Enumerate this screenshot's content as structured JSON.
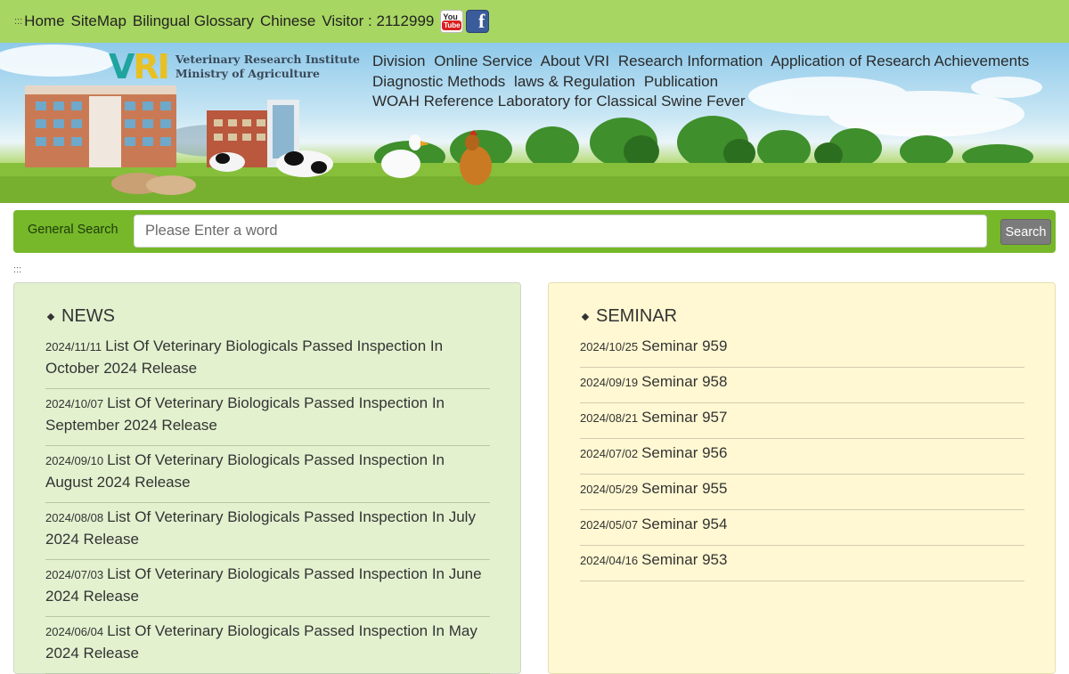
{
  "topbar": {
    "accesskey": ":::",
    "links": [
      "Home",
      "SiteMap",
      "Bilingual Glossary",
      "Chinese"
    ],
    "visitor_label": "Visitor : 2112999",
    "youtube_top": "You",
    "youtube_bottom": "Tube",
    "facebook_glyph": "f"
  },
  "logo": {
    "mark_v": "V",
    "mark_ri": "RI",
    "line1": "Veterinary Research Institute",
    "line2": "Ministry of Agriculture"
  },
  "nav": {
    "row1": [
      "Division",
      "Online Service",
      "About VRI",
      "Research Information",
      "Application of Research Achievements"
    ],
    "row2": [
      "Diagnostic Methods",
      "laws & Regulation",
      "Publication"
    ],
    "row3": [
      "WOAH Reference Laboratory for Classical Swine Fever"
    ]
  },
  "search": {
    "label": "General Search",
    "placeholder": "Please Enter a word",
    "button": "Search"
  },
  "accessmark": ":::",
  "news": {
    "heading": "NEWS",
    "items": [
      {
        "date": "2024/11/11",
        "title": "List Of Veterinary Biologicals Passed Inspection In October 2024 Release"
      },
      {
        "date": "2024/10/07",
        "title": "List Of Veterinary Biologicals Passed Inspection In September 2024 Release"
      },
      {
        "date": "2024/09/10",
        "title": "List Of Veterinary Biologicals Passed Inspection In August 2024 Release"
      },
      {
        "date": "2024/08/08",
        "title": "List Of Veterinary Biologicals Passed Inspection In July 2024 Release"
      },
      {
        "date": "2024/07/03",
        "title": "List Of Veterinary Biologicals Passed Inspection In June 2024 Release"
      },
      {
        "date": "2024/06/04",
        "title": "List Of Veterinary Biologicals Passed Inspection In May 2024 Release"
      }
    ]
  },
  "seminar": {
    "heading": "SEMINAR",
    "items": [
      {
        "date": "2024/10/25",
        "title": "Seminar 959"
      },
      {
        "date": "2024/09/19",
        "title": "Seminar 958"
      },
      {
        "date": "2024/08/21",
        "title": "Seminar 957"
      },
      {
        "date": "2024/07/02",
        "title": "Seminar 956"
      },
      {
        "date": "2024/05/29",
        "title": "Seminar 955"
      },
      {
        "date": "2024/05/07",
        "title": "Seminar 954"
      },
      {
        "date": "2024/04/16",
        "title": "Seminar 953"
      }
    ]
  }
}
